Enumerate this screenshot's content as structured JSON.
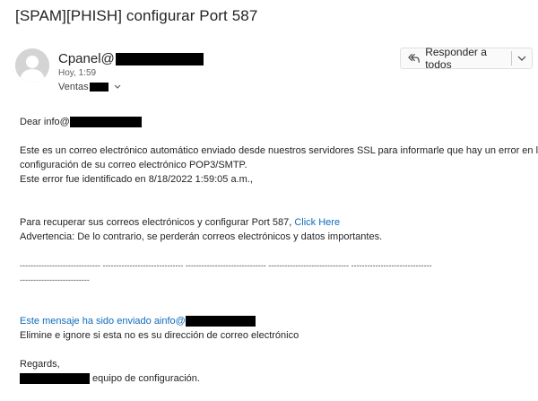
{
  "email": {
    "subject": "[SPAM][PHISH] configurar Port 587",
    "sender_prefix": "Cpanel@",
    "time": "Hoy, 1:59",
    "recipients_prefix": "Ventas",
    "reply_all_label": "Responder a todos"
  },
  "body": {
    "greeting_prefix": "Dear info@",
    "para1_line1": "Este es un correo electrónico automático enviado desde nuestros servidores SSL para informarle que hay un error en la",
    "para1_line2": "configuración de su correo electrónico POP3/SMTP.",
    "para1_line3": "Este error fue identificado en 8/18/2022 1:59:05 a.m.,",
    "para2_prefix": "Para recuperar sus correos electrónicos y configurar Port 587,",
    "click_here": "Click Here",
    "warning": "Advertencia: De lo contrario, se perderán correos electrónicos y datos importantes.",
    "dashes_line1": "------------------------------ ------------------------------ ------------------------------ ------------------------------ ------------------------------",
    "dashes_line2": "--------------------------",
    "sent_to_prefix": "Este mensaje ha sido enviado ainfo@",
    "ignore_text": "Elimine e ignore si esta no es su dirección de correo electrónico",
    "regards": "Regards,",
    "signature_suffix": " equipo de configuración."
  },
  "icons": {
    "reply_all": "reply-all-icon",
    "chevron": "chevron-down-icon",
    "avatar": "person-avatar-icon"
  },
  "colors": {
    "link": "#0f6cbd",
    "redaction": "#000000"
  }
}
